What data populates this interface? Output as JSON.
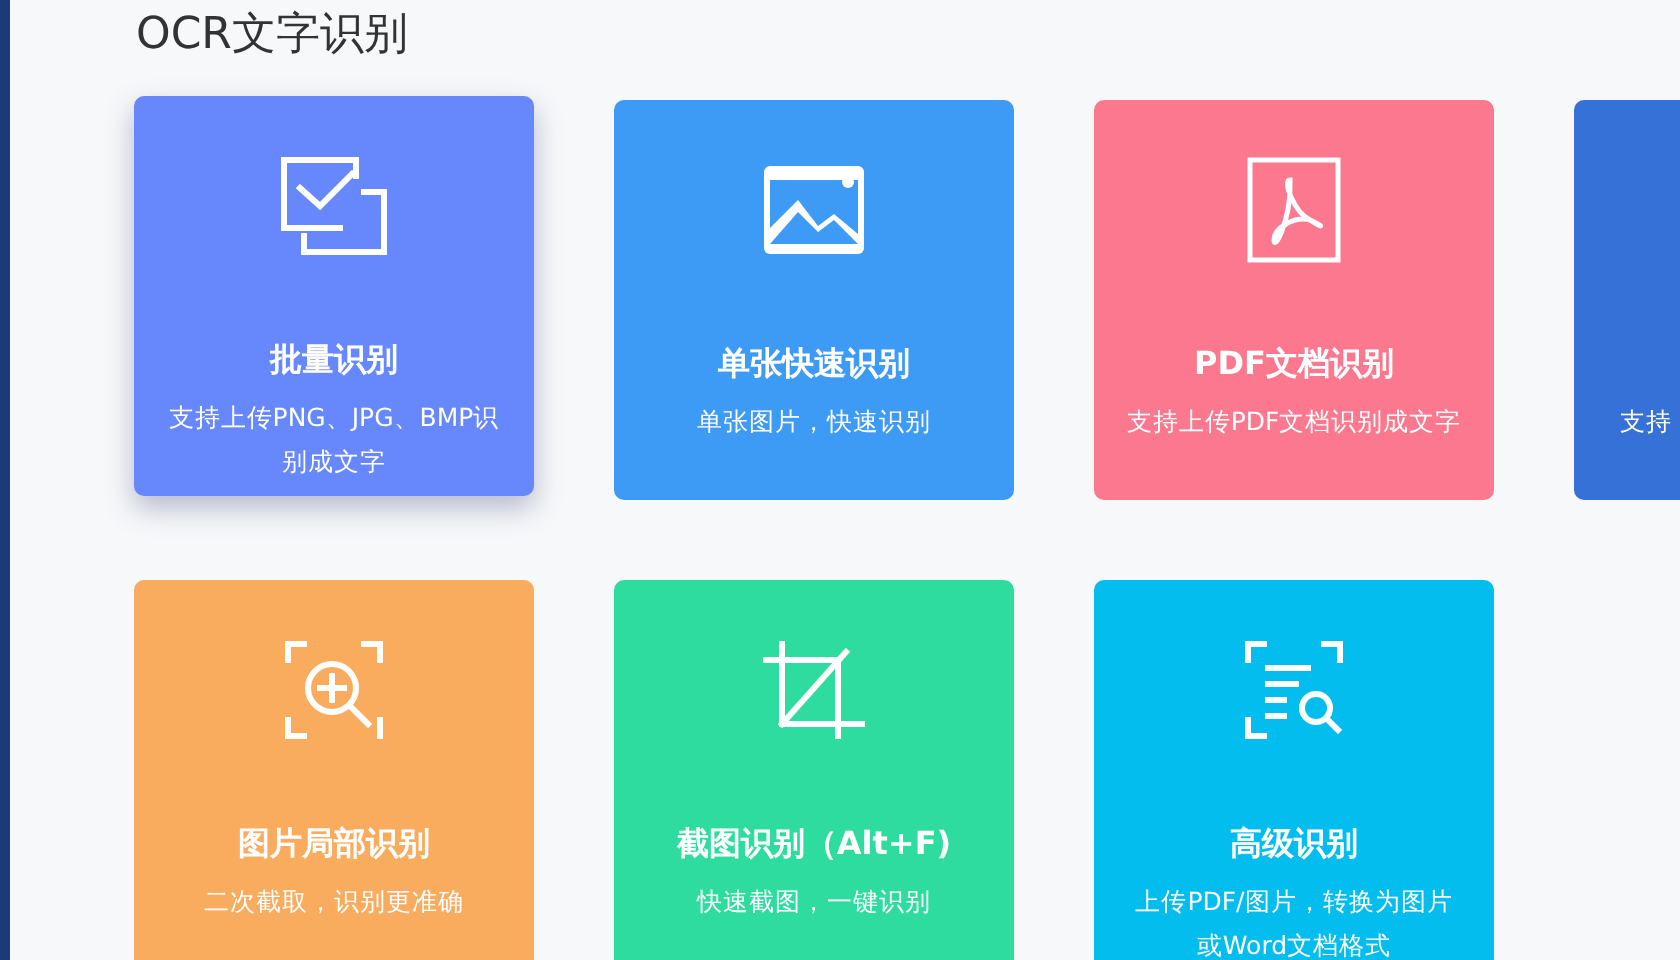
{
  "page_title": "OCR文字识别",
  "cards": [
    {
      "kind": "full",
      "title": "批量识别",
      "description": "支持上传PNG、JPG、BMP识别成文字",
      "color": "#6688fc",
      "hovered": true
    },
    {
      "kind": "full",
      "title": "单张快速识别",
      "description": "单张图片，快速识别",
      "color": "#3d9af5",
      "hovered": false
    },
    {
      "kind": "full",
      "title": "PDF文档识别",
      "description": "支持上传PDF文档识别成文字",
      "color": "#fb788e",
      "hovered": false
    },
    {
      "kind": "clipped",
      "description": "支持",
      "color": "#3571d6",
      "hovered": false
    },
    {
      "kind": "full",
      "title": "图片局部识别",
      "description": "二次截取，识别更准确",
      "color": "#f9ab5e",
      "hovered": false
    },
    {
      "kind": "full",
      "title": "截图识别（Alt+F)",
      "description": "快速截图，一键识别",
      "color": "#2fdc9f",
      "hovered": false
    },
    {
      "kind": "full",
      "title": "高级识别",
      "description": "上传PDF/图片，转换为图片或Word文档格式",
      "color": "#02bdee",
      "hovered": false
    }
  ]
}
